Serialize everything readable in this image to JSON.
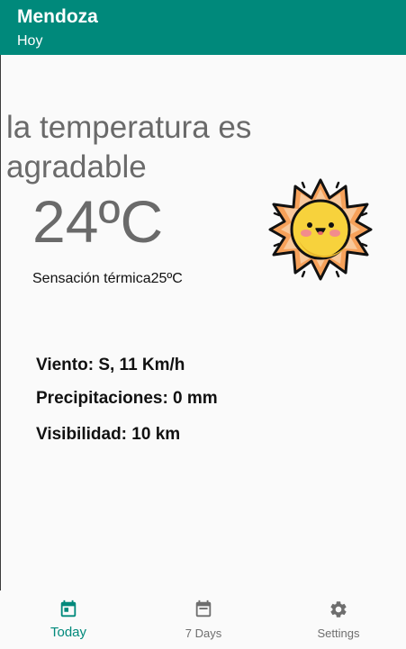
{
  "app_bar": {
    "title": "Mendoza",
    "subtitle": "Hoy"
  },
  "weather": {
    "description": "la temperatura es agradable",
    "temperature": "24ºC",
    "feels_like": "Sensación térmica25ºC",
    "icon": "sun-icon"
  },
  "details": {
    "wind": "Viento: S, 11 Km/h",
    "precipitation": "Precipitaciones: 0 mm",
    "visibility": "Visibilidad: 10 km"
  },
  "bottom_nav": {
    "items": [
      {
        "label": "Today",
        "icon": "calendar-today-icon",
        "active": true
      },
      {
        "label": "7 Days",
        "icon": "calendar-icon",
        "active": false
      },
      {
        "label": "Settings",
        "icon": "gear-icon",
        "active": false
      }
    ]
  },
  "colors": {
    "primary": "#00897b",
    "text_secondary": "#6a6a6a",
    "nav_inactive": "#6e6e6e"
  }
}
